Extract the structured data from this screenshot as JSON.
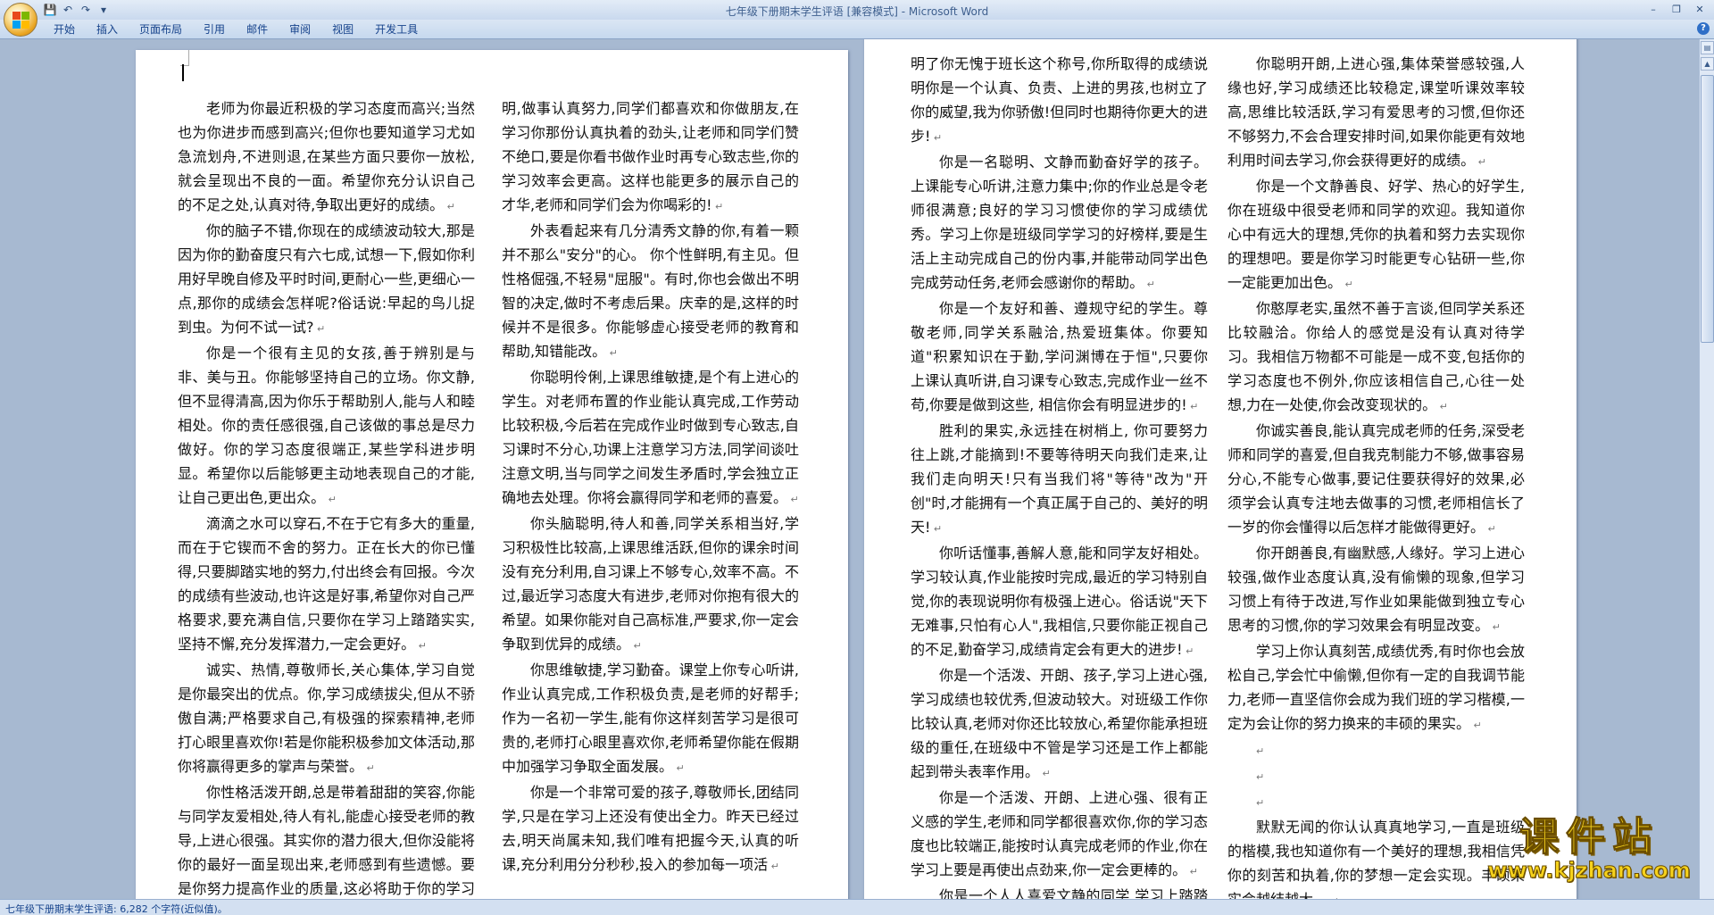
{
  "window": {
    "title": "七年级下册期末学生评语 [兼容模式]",
    "app_suffix": " - Microsoft Word",
    "minimize": "–",
    "restore": "❐",
    "close": "✕"
  },
  "qat": {
    "save_icon": "💾",
    "undo_icon": "↶",
    "redo_icon": "↷",
    "more_icon": "▾"
  },
  "ribbon_tabs": [
    "开始",
    "插入",
    "页面布局",
    "引用",
    "邮件",
    "审阅",
    "视图",
    "开发工具"
  ],
  "help_icon": "?",
  "paragraph_mark": "↵",
  "left_page": {
    "col1": [
      "老师为你最近积极的学习态度而高兴;当然也为你进步而感到高兴;但你也要知道学习尤如急流划舟,不进则退,在某些方面只要你一放松,就会呈现出不良的一面。希望你充分认识自己的不足之处,认真对待,争取出更好的成绩。",
      "你的脑子不错,你现在的成绩波动较大,那是因为你的勤奋度只有六七成,试想一下,假如你利用好早晚自修及平时时间,更耐心一些,更细心一点,那你的成绩会怎样呢?俗话说:早起的鸟儿捉到虫。为何不试一试?",
      "你是一个很有主见的女孩,善于辨别是与非、美与丑。你能够坚持自己的立场。你文静,但不显得清高,因为你乐于帮助别人,能与人和睦相处。你的责任感很强,自己该做的事总是尽力做好。你的学习态度很端正,某些学科进步明显。希望你以后能够更主动地表现自己的才能,让自己更出色,更出众。",
      "滴滴之水可以穿石,不在于它有多大的重量,而在于它锲而不舍的努力。正在长大的你已懂得,只要脚踏实地的努力,付出终会有回报。今次的成绩有些波动,也许这是好事,希望你对自己严格要求,要充满自信,只要你在学习上踏踏实实,坚持不懈,充分发挥潜力,一定会更好。",
      "诚实、热情,尊敬师长,关心集体,学习自觉是你最突出的优点。你,学习成绩拔尖,但从不骄傲自满;严格要求自己,有极强的探索精神,老师打心眼里喜欢你!若是你能积极参加文体活动,那你将赢得更多的掌声与荣誉。",
      "你性格活泼开朗,总是带着甜甜的笑容,你能与同学友爱相处,待人有礼,能虚心接受老师的教导,上进心很强。其实你的潜力很大,但你没能将你的最好一面呈现出来,老师感到有些遗憾。要是你努力提高作业的质量,这必将助于你的学习"
    ],
    "col2": [
      "明,做事认真努力,同学们都喜欢和你做朋友,在学习你那份认真执着的劲头,让老师和同学们赞不绝口,要是你看书做作业时再专心致志些,你的学习效率会更高。这样也能更多的展示自己的才华,老师和同学们会为你喝彩的!",
      "外表看起来有几分清秀文静的你,有着一颗并不那么\"安分\"的心。 你个性鲜明,有主见。但性格倔强,不轻易\"屈服\"。有时,你也会做出不明智的决定,做时不考虑后果。庆幸的是,这样的时候并不是很多。你能够虚心接受老师的教育和帮助,知错能改。",
      "你聪明伶俐,上课思维敏捷,是个有上进心的学生。对老师布置的作业能认真完成,工作劳动比较积极,今后若在完成作业时做到专心致志,自习课时不分心,功课上注意学习方法,同学间谈吐注意文明,当与同学之间发生矛盾时,学会独立正确地去处理。你将会赢得同学和老师的喜爱。",
      "你头脑聪明,待人和善,同学关系相当好,学习积极性比较高,上课思维活跃,但你的课余时间没有充分利用,自习课上不够专心,效率不高。不过,最近学习态度大有进步,老师对你抱有很大的希望。如果你能对自己高标准,严要求,你一定会争取到优异的成绩。",
      "你思维敏捷,学习勤奋。课堂上你专心听讲,作业认真完成,工作积极负责,是老师的好帮手;作为一名初一学生,能有你这样刻苦学习是很可贵的,老师打心眼里喜欢你,老师希望你能在假期中加强学习争取全面发展。",
      "你是一个非常可爱的孩子,尊敬师长,团结同学,只是在学习上还没有使出全力。昨天已经过去,明天尚属未知,我们唯有把握今天,认真的听课,充分利用分分秒秒,投入的参加每一项活"
    ]
  },
  "right_page": {
    "col1": [
      "明了你无愧于班长这个称号,你所取得的成绩说明你是一个认真、负责、上进的男孩,也树立了你的威望,我为你骄傲!但同时也期待你更大的进步!",
      "你是一名聪明、文静而勤奋好学的孩子。上课能专心听讲,注意力集中;你的作业总是令老师很满意;良好的学习习惯使你的学习成绩优秀。学习上你是班级同学学习的好榜样,要是生活上主动完成自己的份内事,并能带动同学出色完成劳动任务,老师会感谢你的帮助。",
      "你是一个友好和善、遵规守纪的学生。尊敬老师,同学关系融洽,热爱班集体。你要知道\"积累知识在于勤,学问渊博在于恒\",只要你 上课认真听讲,自习课专心致志,完成作业一丝不苟,你要是做到这些, 相信你会有明显进步的!",
      "胜利的果实,永远挂在树梢上, 你可要努力往上跳,才能摘到!不要等待明天向我们走来,让我们走向明天!只有当我们将\"等待\"改为\"开创\"时,才能拥有一个真正属于自己的、美好的明天!",
      "你听话懂事,善解人意,能和同学友好相处。学习较认真,作业能按时完成,最近的学习特别自觉,你的表现说明你有极强上进心。俗话说\"天下无难事,只怕有心人\",我相信,只要你能正视自己的不足,勤奋学习,成绩肯定会有更大的进步!",
      "你是一个活泼、开朗、孩子,学习上进心强,学习成绩也较优秀,但波动较大。对班级工作你比较认真,老师对你还比较放心,希望你能承担班级的重任,在班级中不管是学习还是工作上都能起到带头表率作用。",
      "你是一个活泼、开朗、上进心强、很有正义感的学生,老师和同学都很喜欢你,你的学习态度也比较端正,能按时认真完成老师的作业,你在学习上要是再使出点劲来,你一定会更棒的。",
      "你是一个人人喜爱文静的同学,学习上踏踏实实,完成作业认认真真,听课很专注,自修课"
    ],
    "col2": [
      "你聪明开朗,上进心强,集体荣誉感较强,人缘也好,学习成绩还比较稳定,课堂听课效率较高,思维比较活跃,学习有爱思考的习惯,但你还不够努力,不会合理安排时间,如果你能更有效地利用时间去学习,你会获得更好的成绩。",
      "你是一个文静善良、好学、热心的好学生,你在班级中很受老师和同学的欢迎。我知道你心中有远大的理想,凭你的执着和努力去实现你的理想吧。要是你学习时能更专心钻研一些,你一定能更加出色。",
      "你憨厚老实,虽然不善于言谈,但同学关系还比较融洽。你给人的感觉是没有认真对待学习。我相信万物都不可能是一成不变,包括你的学习态度也不例外,你应该相信自己,心往一处想,力在一处使,你会改变现状的。",
      "你诚实善良,能认真完成老师的任务,深受老师和同学的喜爱,但自我克制能力不够,做事容易分心,不能专心做事,要记住要获得好的效果,必须学会认真专注地去做事的习惯,老师相信长了一岁的你会懂得以后怎样才能做得更好。",
      "你开朗善良,有幽默感,人缘好。学习上进心较强,做作业态度认真,没有偷懒的现象,但学习习惯上有待于改进,写作业如果能做到独立专心思考的习惯,你的学习效果会有明显改变。",
      "学习上你认真刻苦,成绩优秀,有时你也会放松自己,学会忙中偷懒,但你有一定的自我调节能力,老师一直坚信你会成为我们班的学习楷模,一定为会让你的努力换来的丰硕的果实。",
      "",
      "",
      "",
      "默默无闻的你认认真真地学习,一直是班级的楷模,我也知道你有一个美好的理想,我相信凭你的刻苦和执着,你的梦想一定会实现。丰硕果实会越结越大。"
    ]
  },
  "status_bar": {
    "text": "七年级下册期末学生评语: 6,282 个字符(近似值)。"
  },
  "watermark": {
    "title": "课件站",
    "url": "www.kjzhan.com"
  }
}
